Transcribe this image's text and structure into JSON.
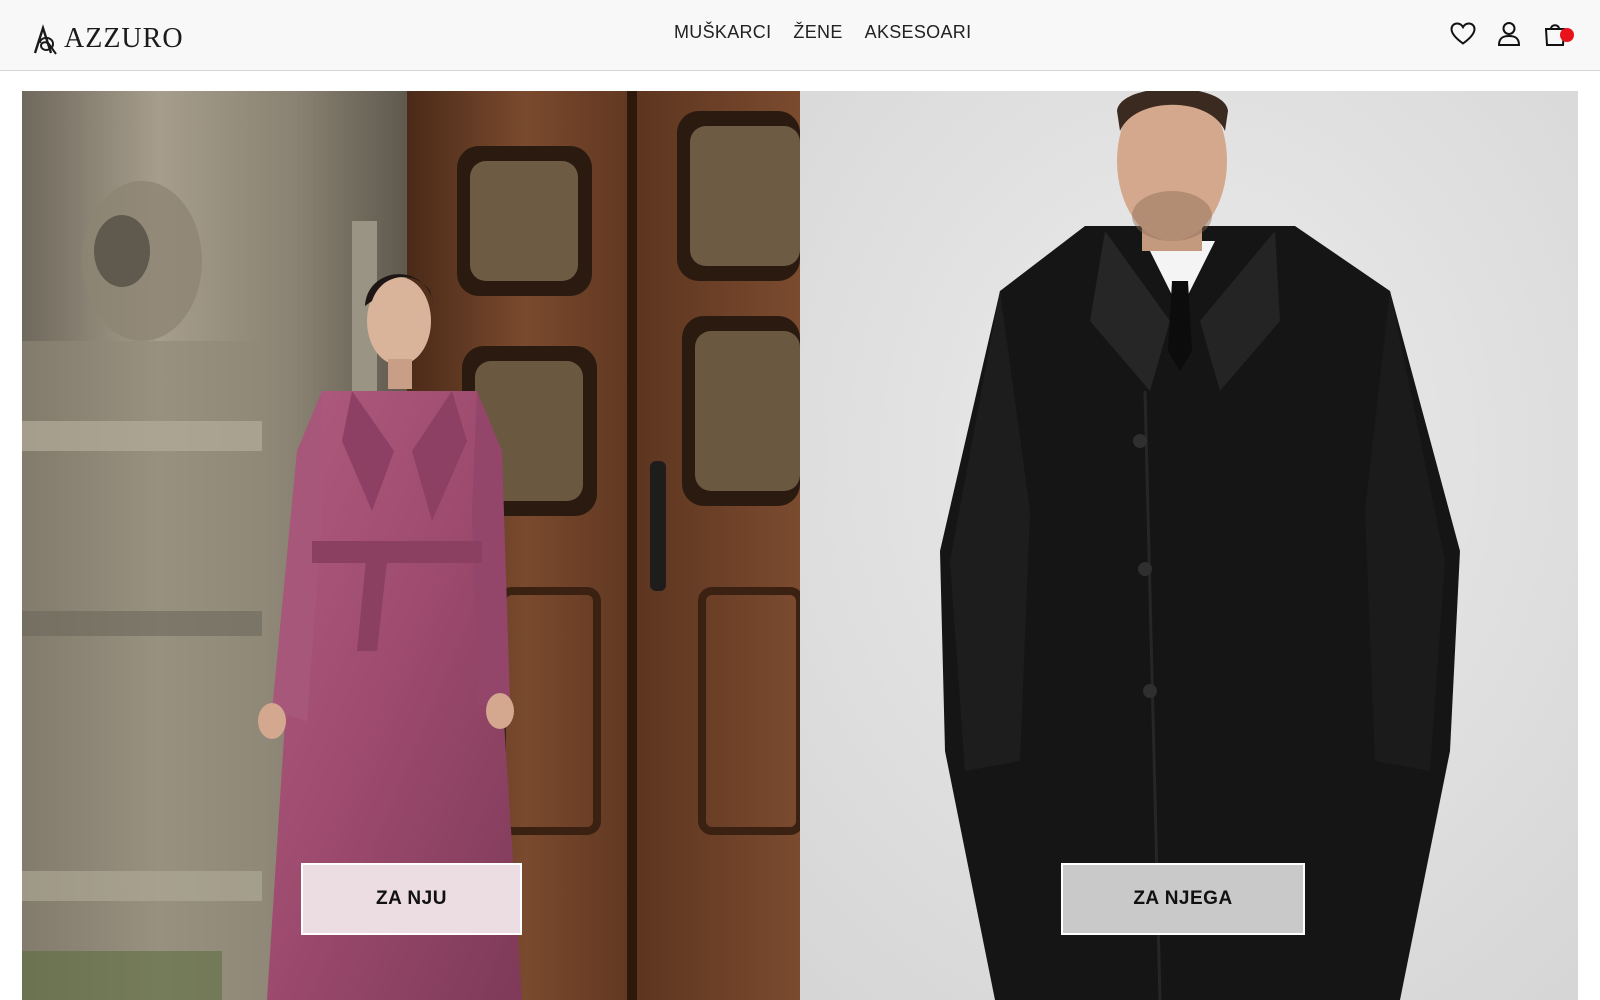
{
  "brand": {
    "name": "AZZURO",
    "logo_icon": "azzuro-monogram-icon"
  },
  "nav": {
    "items": [
      {
        "label": "MUŠKARCI"
      },
      {
        "label": "ŽENE"
      },
      {
        "label": "AKSESOARI"
      }
    ]
  },
  "header_icons": {
    "wishlist": "heart-icon",
    "account": "user-icon",
    "cart": "shopping-bag-icon",
    "cart_badge_color": "#e8121b"
  },
  "hero": {
    "left": {
      "button_label": "ZA NJU",
      "button_bg": "#ecdde3",
      "image_icon": "woman-pink-coat-photo"
    },
    "right": {
      "button_label": "ZA NJEGA",
      "button_bg": "#c9c9c9",
      "image_icon": "man-black-coat-photo"
    }
  },
  "colors": {
    "header_bg": "#f8f8f8",
    "text": "#222222"
  }
}
